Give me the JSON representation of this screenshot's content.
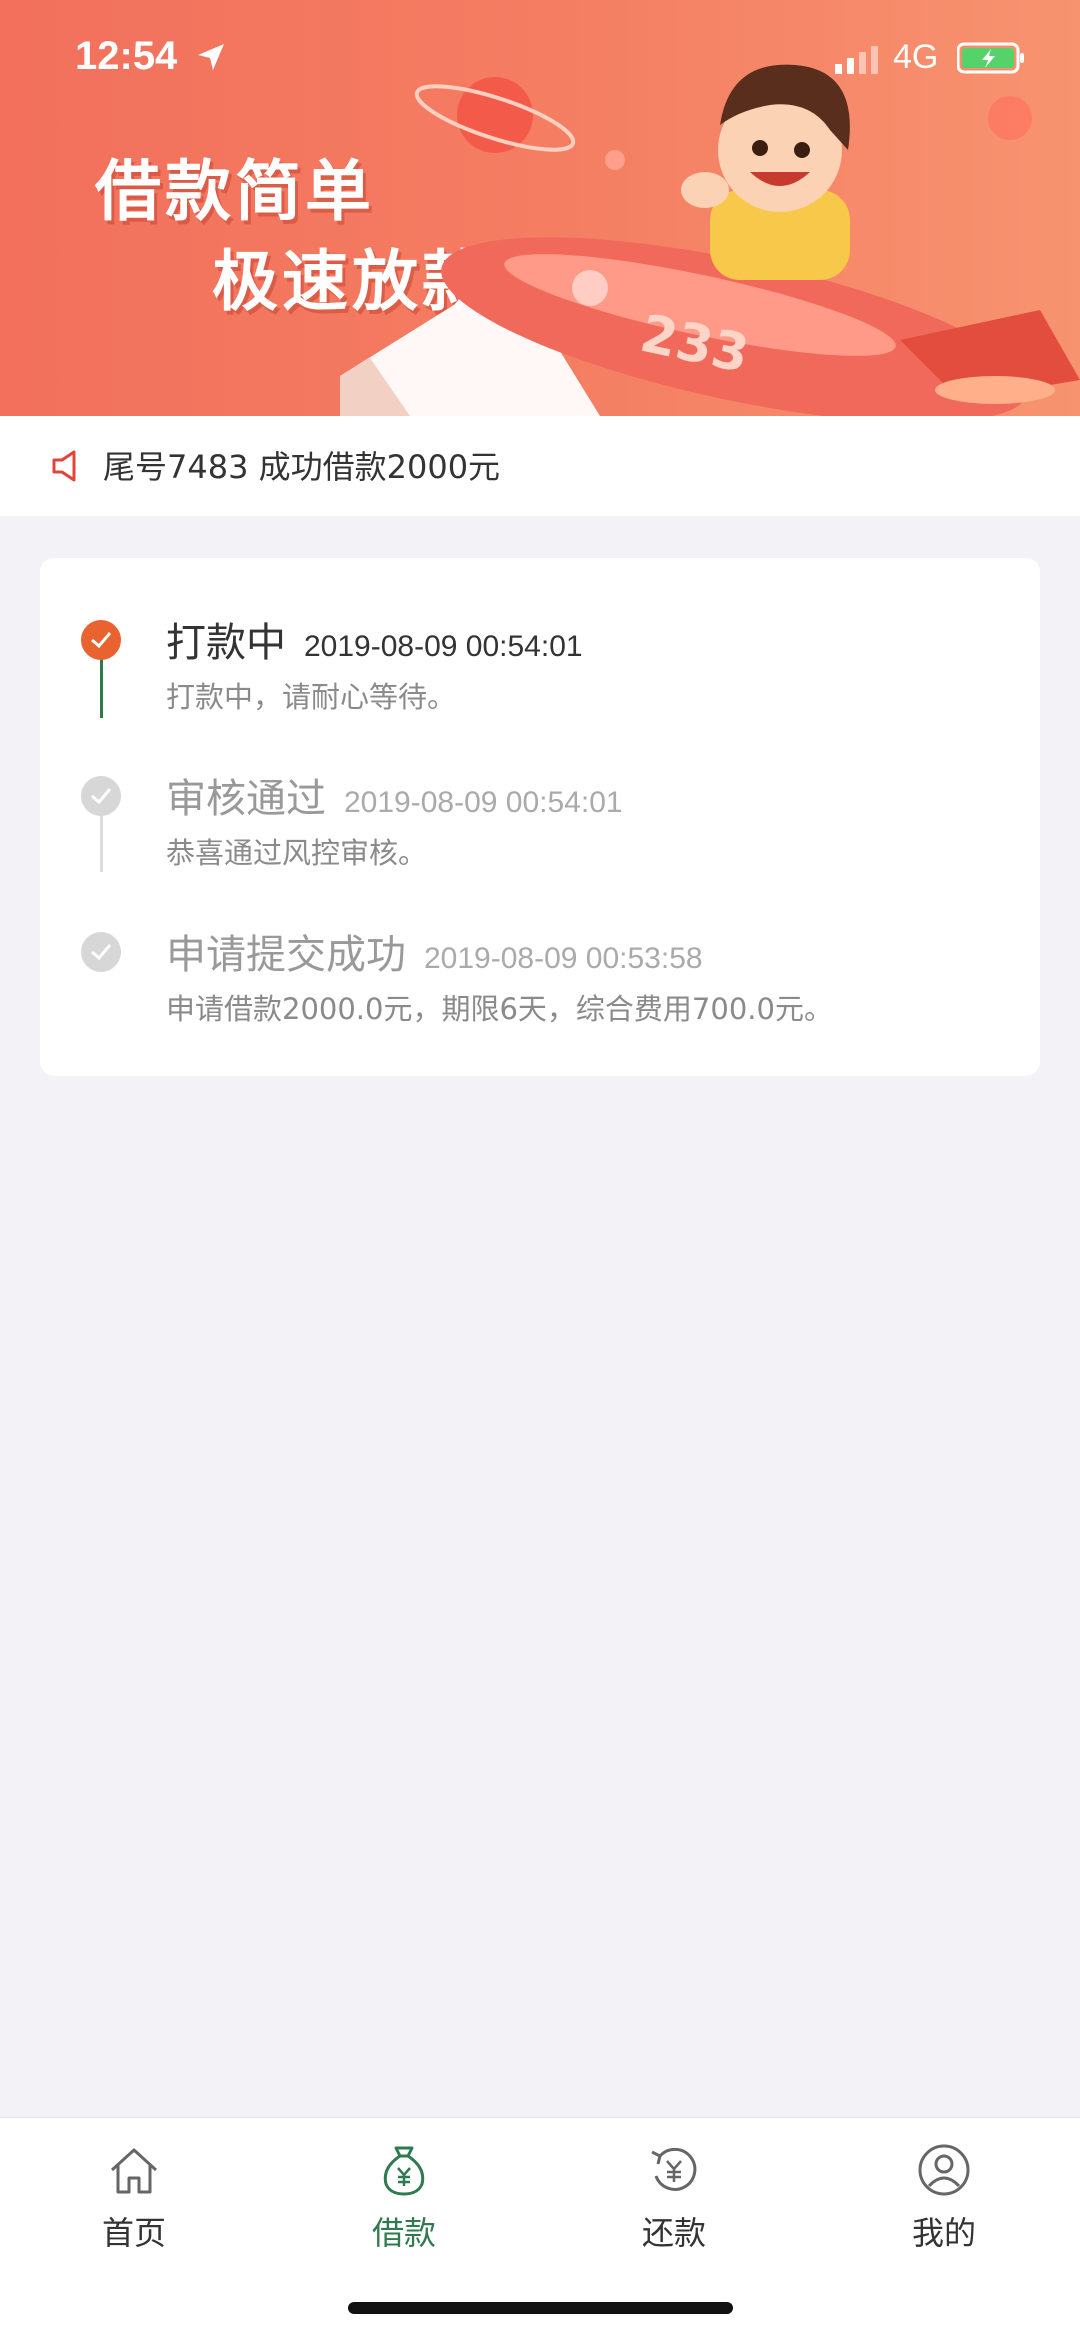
{
  "status_bar": {
    "time": "12:54",
    "network": "4G"
  },
  "banner": {
    "line1": "借款简单",
    "line2": "极速放款",
    "rocket_number": "233"
  },
  "notice": {
    "text": "尾号7483 成功借款2000元"
  },
  "steps": [
    {
      "title": "打款中",
      "time": "2019-08-09 00:54:01",
      "desc": "打款中，请耐心等待。",
      "state": "active"
    },
    {
      "title": "审核通过",
      "time": "2019-08-09 00:54:01",
      "desc": "恭喜通过风控审核。",
      "state": "done"
    },
    {
      "title": "申请提交成功",
      "time": "2019-08-09 00:53:58",
      "desc": "申请借款2000.0元，期限6天，综合费用700.0元。",
      "state": "done"
    }
  ],
  "tabs": [
    {
      "label": "首页",
      "icon": "home-icon"
    },
    {
      "label": "借款",
      "icon": "money-bag-icon",
      "active": true
    },
    {
      "label": "还款",
      "icon": "repay-icon"
    },
    {
      "label": "我的",
      "icon": "profile-icon"
    }
  ],
  "colors": {
    "accent": "#e8632f",
    "tab_active": "#2f7a4f",
    "banner": "#f47d62"
  }
}
